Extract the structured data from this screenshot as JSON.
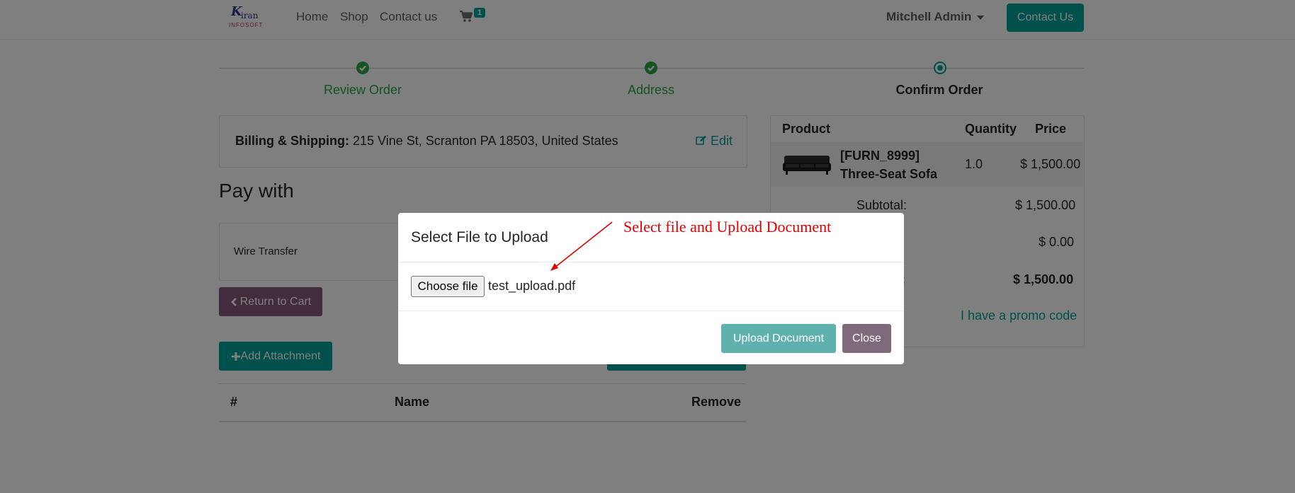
{
  "brand": {
    "logo_main": "K",
    "logo_rest": "iran",
    "logo_sub": "INFOSOFT"
  },
  "nav": {
    "links": [
      "Home",
      "Shop",
      "Contact us"
    ],
    "cart_count": "1",
    "user": "Mitchell Admin",
    "contact_button": "Contact Us"
  },
  "wizard": {
    "steps": [
      {
        "label": "Review Order",
        "state": "done"
      },
      {
        "label": "Address",
        "state": "done"
      },
      {
        "label": "Confirm Order",
        "state": "current"
      }
    ]
  },
  "billing": {
    "label": "Billing & Shipping:",
    "address": "215 Vine St, Scranton PA 18503, United States",
    "edit_label": "Edit"
  },
  "payment": {
    "title": "Pay with",
    "method": "Wire Transfer",
    "return_button": "Return to Cart",
    "attach_button": "Add Attachment"
  },
  "attachments_table": {
    "headers": [
      "#",
      "Name",
      "Remove"
    ]
  },
  "order": {
    "headers": {
      "product": "Product",
      "quantity": "Quantity",
      "price": "Price"
    },
    "item": {
      "name": "[FURN_8999] Three-Seat Sofa",
      "quantity": "1.0",
      "price": "$ 1,500.00"
    },
    "subtotal_label": "Subtotal:",
    "subtotal": "$ 1,500.00",
    "taxes_label_tail": ":",
    "taxes": "$ 0.00",
    "total_label_tail": ":",
    "total": "$ 1,500.00",
    "promo_link": "I have a promo code"
  },
  "modal": {
    "title": "Select File to Upload",
    "choose_file": "Choose file",
    "file_name": "test_upload.pdf",
    "upload_button": "Upload Document",
    "close_button": "Close"
  },
  "annotation": {
    "text": "Select file and Upload Document",
    "color": "#e00000"
  },
  "colors": {
    "primary": "#00a09d",
    "secondary": "#875a7b",
    "success": "#28a745"
  }
}
